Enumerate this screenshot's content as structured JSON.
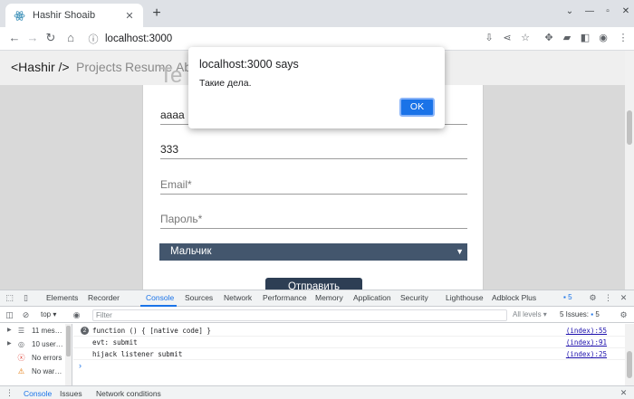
{
  "browser": {
    "tab_title": "Hashir Shoaib",
    "new_tab": "+",
    "url": "localhost:3000"
  },
  "site": {
    "brand": "<Hashir />",
    "nav": [
      "Projects",
      "Resume",
      "Ab"
    ],
    "hero_fragment": "Te"
  },
  "form": {
    "name_value": "aaaa",
    "phone_value": "333",
    "email_placeholder": "Email*",
    "password_placeholder": "Пароль*",
    "gender_selected": "Мальчик",
    "submit_label": "Отправить"
  },
  "alert": {
    "title": "localhost:3000 says",
    "message": "Такие дела.",
    "ok_label": "OK"
  },
  "devtools": {
    "tabs": [
      "Elements",
      "Recorder",
      "Console",
      "Sources",
      "Network",
      "Performance",
      "Memory",
      "Application",
      "Security",
      "Lighthouse",
      "Adblock Plus"
    ],
    "active_tab": "Console",
    "issues_badge": "5",
    "context": "top",
    "filter_placeholder": "Filter",
    "levels": "All levels",
    "issues_label": "5 Issues:",
    "issues_count": "5",
    "sidebar": [
      {
        "label": "11 mes…",
        "icon": "list-icon"
      },
      {
        "label": "10 user…",
        "icon": "user-icon"
      },
      {
        "label": "No errors",
        "icon": "error-icon"
      },
      {
        "label": "No war…",
        "icon": "warning-icon"
      }
    ],
    "logs": [
      {
        "count": "2",
        "message": "function () { [native code] }",
        "source": "(index):55"
      },
      {
        "count": "",
        "message": "evt: submit",
        "source": "(index):91"
      },
      {
        "count": "",
        "message": "hijack listener  submit",
        "source": "(index):25"
      }
    ],
    "prompt": "›",
    "drawer_tabs": [
      "Console",
      "Issues",
      "Network conditions"
    ]
  },
  "colors": {
    "accent": "#1a73e8",
    "select_bg": "#43566d",
    "button_bg": "#2d3e54"
  }
}
